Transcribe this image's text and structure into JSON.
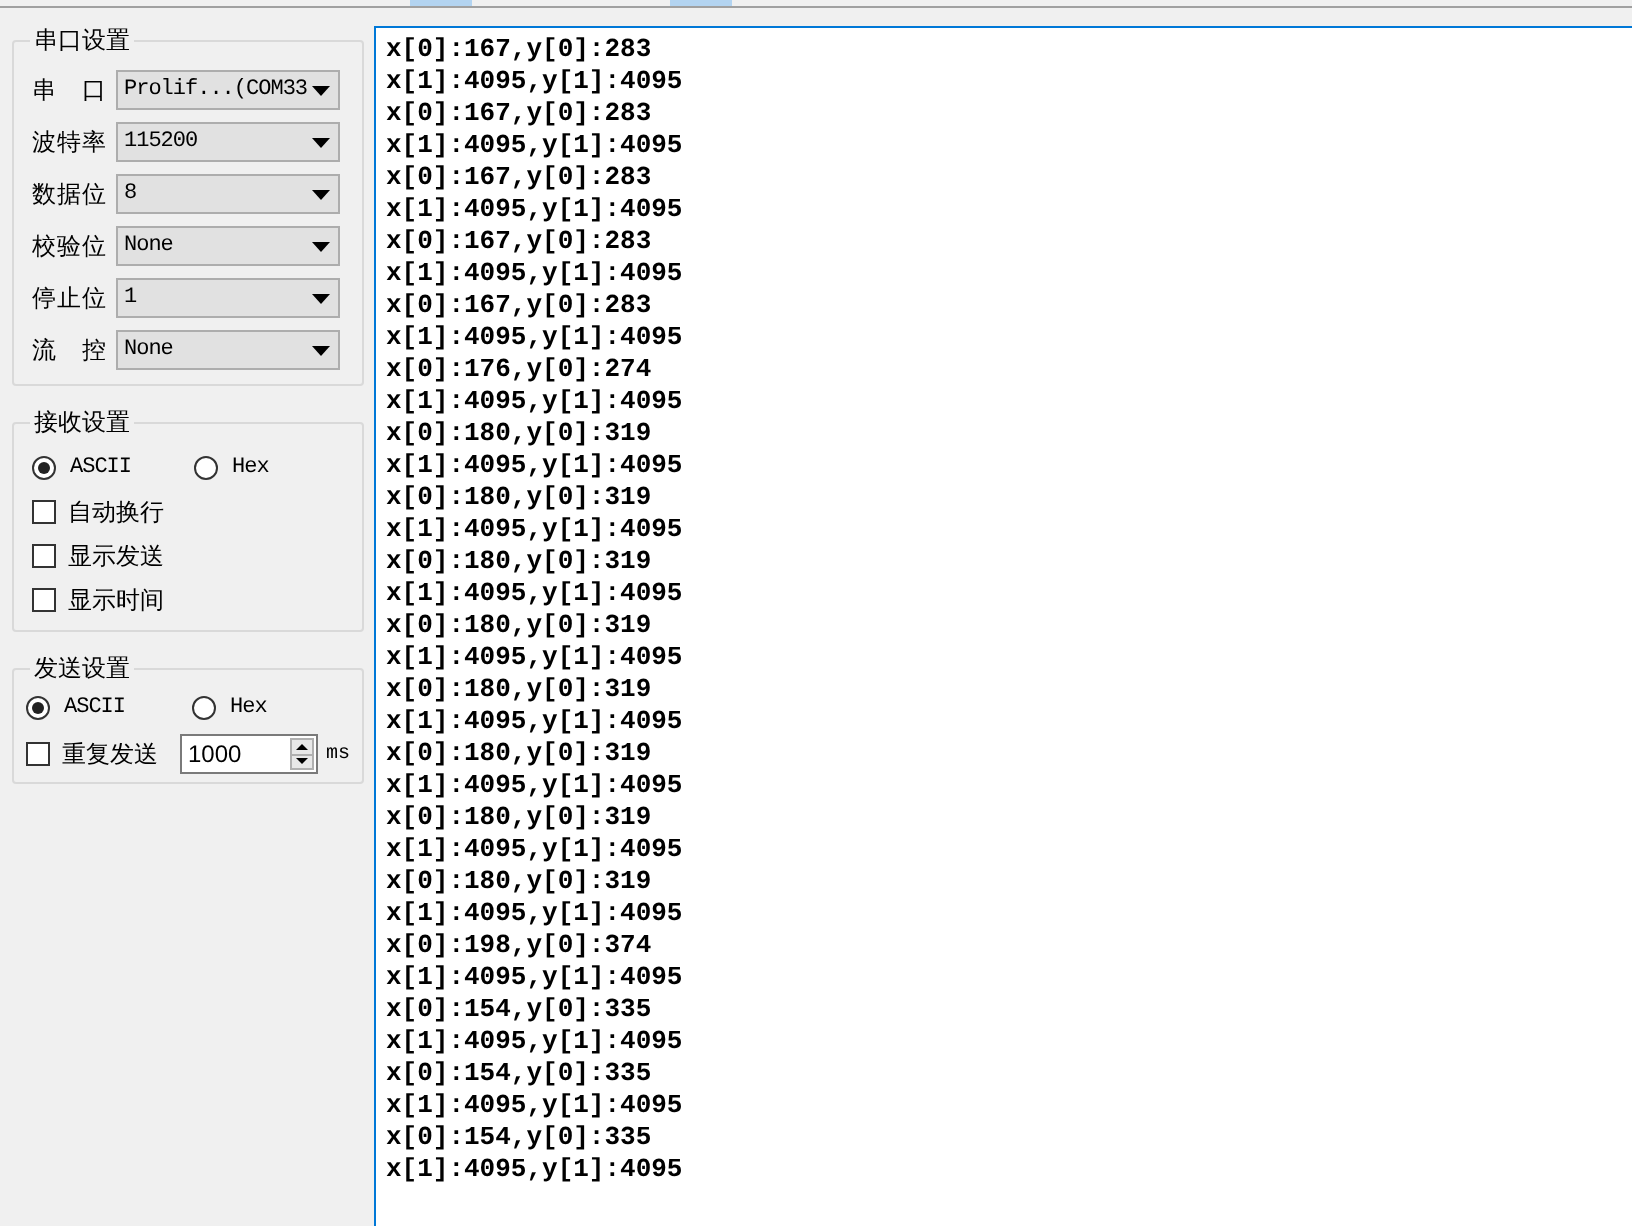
{
  "serial_settings": {
    "title": "串口设置",
    "fields": [
      {
        "label": "串 口",
        "value": "Prolif...(COM33"
      },
      {
        "label": "波特率",
        "value": "115200"
      },
      {
        "label": "数据位",
        "value": "8"
      },
      {
        "label": "校验位",
        "value": "None"
      },
      {
        "label": "停止位",
        "value": "1"
      },
      {
        "label": "流 控",
        "value": "None"
      }
    ]
  },
  "receive_settings": {
    "title": "接收设置",
    "modes": [
      {
        "label": "ASCII",
        "selected": true
      },
      {
        "label": "Hex",
        "selected": false
      }
    ],
    "options": [
      {
        "label": "自动换行",
        "checked": false
      },
      {
        "label": "显示发送",
        "checked": false
      },
      {
        "label": "显示时间",
        "checked": false
      }
    ]
  },
  "send_settings": {
    "title": "发送设置",
    "modes": [
      {
        "label": "ASCII",
        "selected": true
      },
      {
        "label": "Hex",
        "selected": false
      }
    ],
    "repeat": {
      "label": "重复发送",
      "checked": false,
      "interval": "1000",
      "unit": "ms"
    }
  },
  "receive_log": {
    "lines": [
      "x[0]:167,y[0]:283",
      "x[1]:4095,y[1]:4095",
      "x[0]:167,y[0]:283",
      "x[1]:4095,y[1]:4095",
      "x[0]:167,y[0]:283",
      "x[1]:4095,y[1]:4095",
      "x[0]:167,y[0]:283",
      "x[1]:4095,y[1]:4095",
      "x[0]:167,y[0]:283",
      "x[1]:4095,y[1]:4095",
      "x[0]:176,y[0]:274",
      "x[1]:4095,y[1]:4095",
      "x[0]:180,y[0]:319",
      "x[1]:4095,y[1]:4095",
      "x[0]:180,y[0]:319",
      "x[1]:4095,y[1]:4095",
      "x[0]:180,y[0]:319",
      "x[1]:4095,y[1]:4095",
      "x[0]:180,y[0]:319",
      "x[1]:4095,y[1]:4095",
      "x[0]:180,y[0]:319",
      "x[1]:4095,y[1]:4095",
      "x[0]:180,y[0]:319",
      "x[1]:4095,y[1]:4095",
      "x[0]:180,y[0]:319",
      "x[1]:4095,y[1]:4095",
      "x[0]:180,y[0]:319",
      "x[1]:4095,y[1]:4095",
      "x[0]:198,y[0]:374",
      "x[1]:4095,y[1]:4095",
      "x[0]:154,y[0]:335",
      "x[1]:4095,y[1]:4095",
      "x[0]:154,y[0]:335",
      "x[1]:4095,y[1]:4095",
      "x[0]:154,y[0]:335",
      "x[1]:4095,y[1]:4095"
    ]
  }
}
